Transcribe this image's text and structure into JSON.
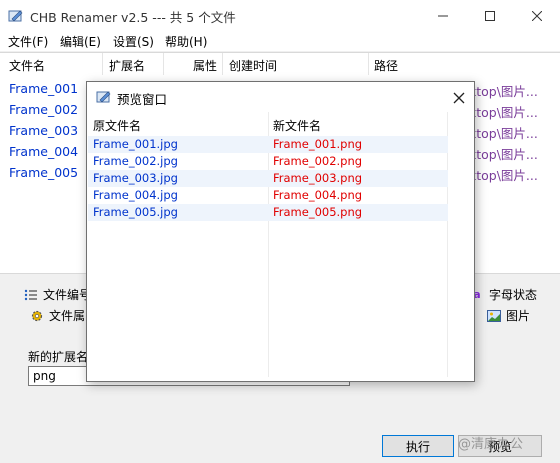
{
  "window": {
    "title": "CHB Renamer v2.5 --- 共 5 个文件"
  },
  "menu": [
    "文件(F)",
    "编辑(E)",
    "设置(S)",
    "帮助(H)"
  ],
  "list": {
    "headers": [
      "文件名",
      "扩展名",
      "属性",
      "创建时间",
      "路径"
    ],
    "rows": [
      {
        "name": "Frame_001",
        "path": "ktop\\图片..."
      },
      {
        "name": "Frame_002",
        "path": "ktop\\图片..."
      },
      {
        "name": "Frame_003",
        "path": "ktop\\图片..."
      },
      {
        "name": "Frame_004",
        "path": "ktop\\图片..."
      },
      {
        "name": "Frame_005",
        "path": "ktop\\图片..."
      }
    ]
  },
  "options": {
    "file_number": "文件编号",
    "file_attr": "文件属",
    "letter_case": "字母状态",
    "picture": "图片"
  },
  "extension": {
    "label": "新的扩展名",
    "value": "png"
  },
  "buttons": {
    "run": "执行",
    "preview": "预览"
  },
  "watermark": "@清康办公",
  "preview_dialog": {
    "title": "预览窗口",
    "headers": [
      "原文件名",
      "新文件名"
    ],
    "rows": [
      {
        "original": "Frame_001.jpg",
        "new": "Frame_001.png"
      },
      {
        "original": "Frame_002.jpg",
        "new": "Frame_002.png"
      },
      {
        "original": "Frame_003.jpg",
        "new": "Frame_003.png"
      },
      {
        "original": "Frame_004.jpg",
        "new": "Frame_004.png"
      },
      {
        "original": "Frame_005.jpg",
        "new": "Frame_005.png"
      }
    ]
  },
  "colors": {
    "filename_blue": "#0033cc",
    "newname_red": "#e00000",
    "path_purple": "#7a3d9a",
    "row_alt": "#eef4fc"
  }
}
